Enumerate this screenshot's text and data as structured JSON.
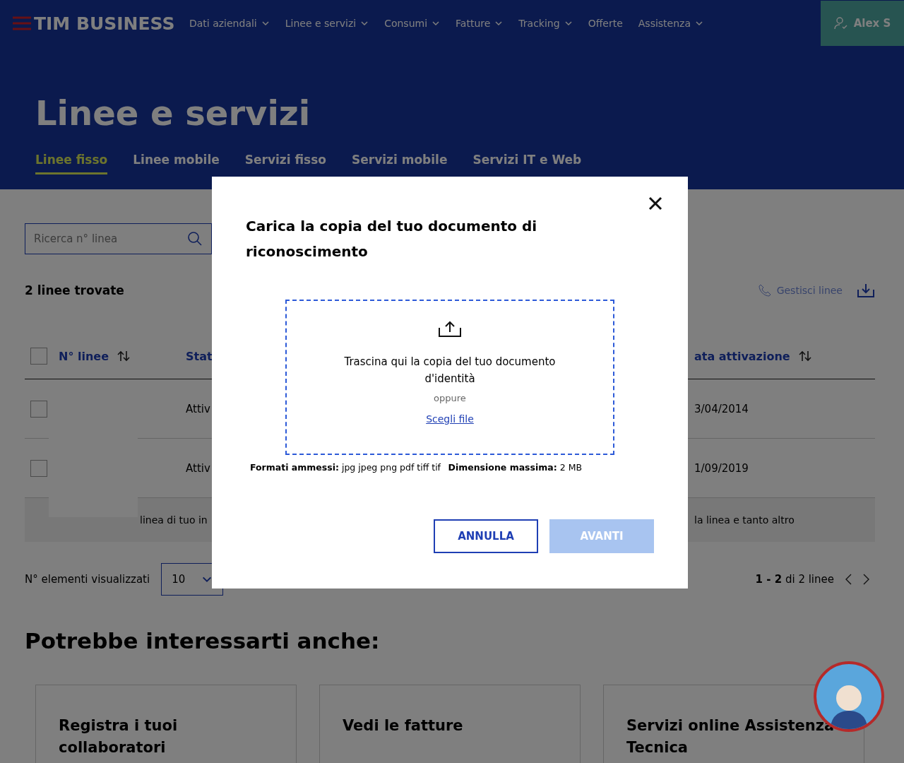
{
  "header": {
    "logo": "TIM BUSINESS",
    "nav": [
      {
        "label": "Dati aziendali",
        "has_menu": true
      },
      {
        "label": "Linee e servizi",
        "has_menu": true
      },
      {
        "label": "Consumi",
        "has_menu": true
      },
      {
        "label": "Fatture",
        "has_menu": true
      },
      {
        "label": "Tracking",
        "has_menu": true
      },
      {
        "label": "Offerte",
        "has_menu": false
      },
      {
        "label": "Assistenza",
        "has_menu": true
      }
    ],
    "user": "Alex S"
  },
  "page_title": "Linee e servizi",
  "tabs": [
    {
      "label": "Linee fisso",
      "selected": true
    },
    {
      "label": "Linee mobile",
      "selected": false
    },
    {
      "label": "Servizi fisso",
      "selected": false
    },
    {
      "label": "Servizi mobile",
      "selected": false
    },
    {
      "label": "Servizi IT e Web",
      "selected": false
    }
  ],
  "search": {
    "placeholder": "Ricerca n° linea"
  },
  "results_count": "2 linee trovate",
  "actions": {
    "manage": {
      "label": "Gestisci linee",
      "disabled": true
    }
  },
  "table": {
    "select_all": {
      "checked": false
    },
    "columns": [
      {
        "label": "N° linee"
      },
      {
        "label": "Stat"
      },
      {
        "label": "ata attivazione"
      }
    ],
    "rows": [
      {
        "checked": false,
        "status": "Attiv",
        "date": "3/04/2014"
      },
      {
        "checked": false,
        "status": "Attiv",
        "date": "1/09/2019"
      }
    ],
    "info_left": "linea di tuo in",
    "info_right": "la linea e tanto altro"
  },
  "page_size": {
    "label": "N° elementi visualizzati",
    "value": "10"
  },
  "pagination": "**1 - 2** di 2 linee",
  "related": {
    "title": "Potrebbe interessarti anche:",
    "cards": [
      "Registra i tuoi collaboratori",
      "Vedi le fatture",
      "Servizi online Assistenza Tecnica"
    ]
  },
  "modal": {
    "title": "Carica la copia del tuo documento di riconoscimento",
    "drop_text": "Trascina qui la copia del tuo documento d'identità",
    "or": "oppure",
    "choose": "Scegli file",
    "formats": "**Formati ammessi:** jpg jpeg png pdf tiff tif",
    "max_size": "**Dimensione massima:** 2 MB",
    "buttons": [
      {
        "label": "ANNULLA",
        "kind": "secondary",
        "disabled": false
      },
      {
        "label": "AVANTI",
        "kind": "primary",
        "disabled": true
      }
    ]
  }
}
